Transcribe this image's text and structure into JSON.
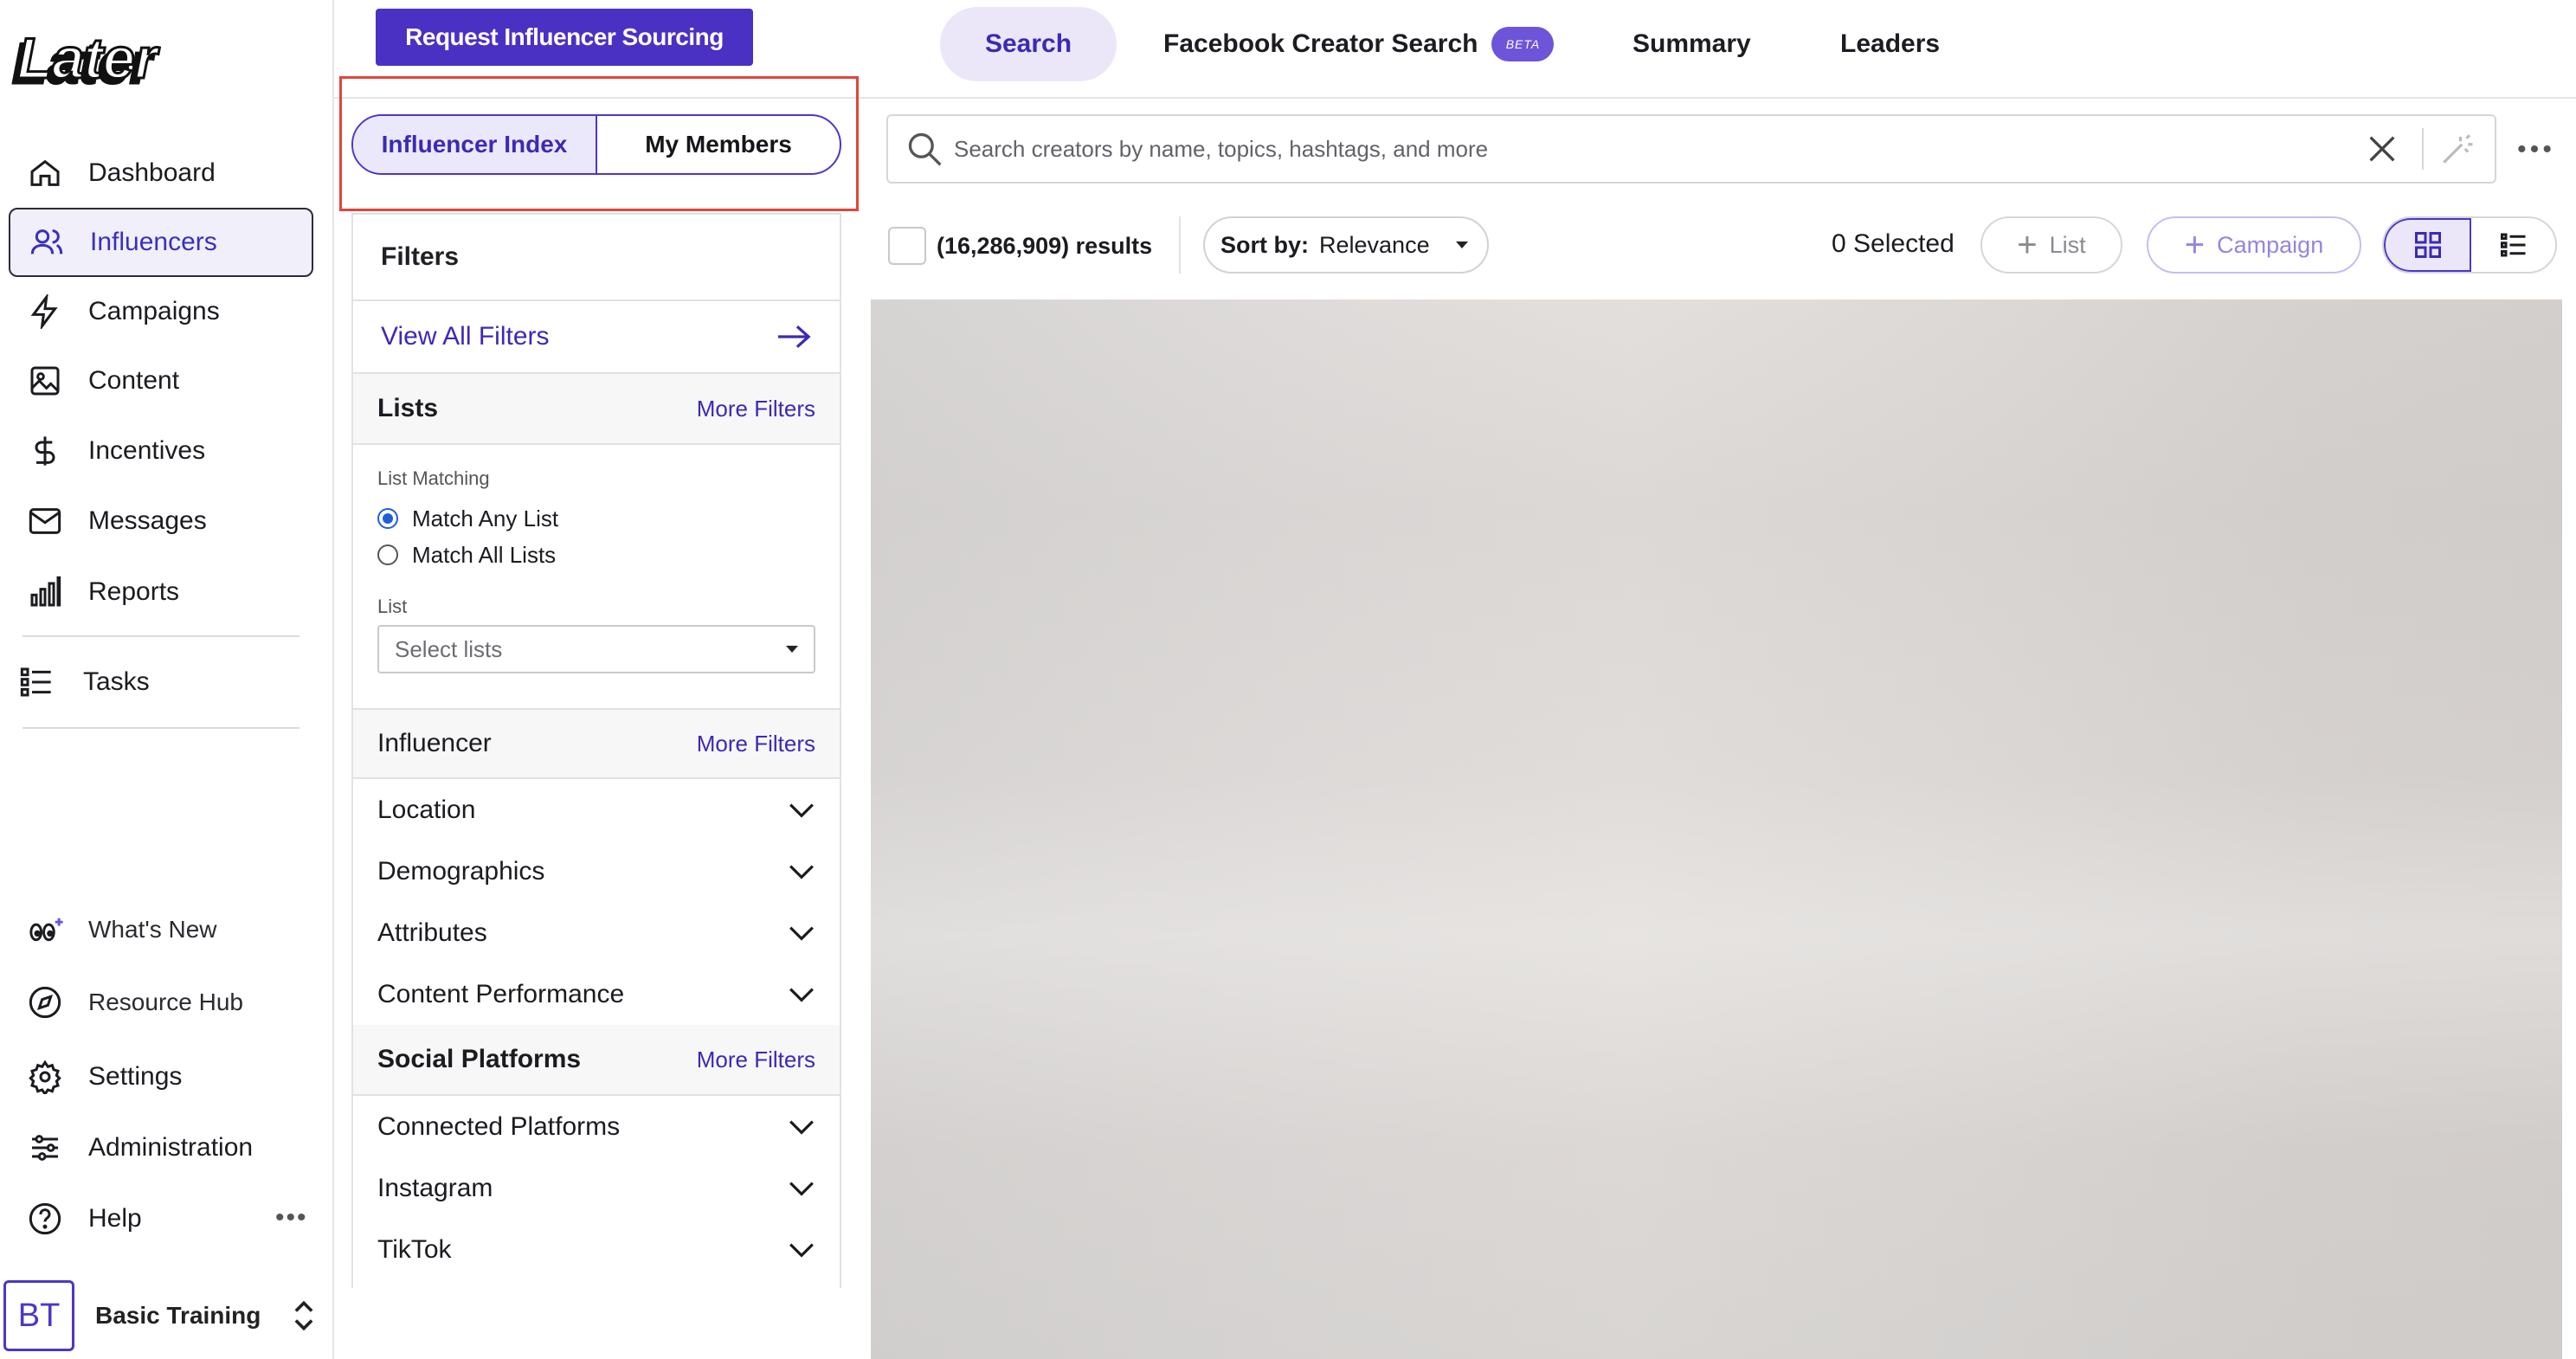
{
  "sidebar": {
    "logo_text": "Later",
    "items": [
      {
        "label": "Dashboard",
        "icon": "home-icon"
      },
      {
        "label": "Influencers",
        "icon": "users-icon",
        "active": true
      },
      {
        "label": "Campaigns",
        "icon": "bolt-icon"
      },
      {
        "label": "Content",
        "icon": "image-icon"
      },
      {
        "label": "Incentives",
        "icon": "dollar-icon"
      },
      {
        "label": "Messages",
        "icon": "mail-icon"
      },
      {
        "label": "Reports",
        "icon": "bar-chart-icon"
      },
      {
        "label": "Tasks",
        "icon": "checklist-icon"
      }
    ],
    "bottom_items": [
      {
        "label": "What's New",
        "icon": "eyes-sparkle-icon"
      },
      {
        "label": "Resource Hub",
        "icon": "compass-icon"
      },
      {
        "label": "Settings",
        "icon": "gear-icon"
      },
      {
        "label": "Administration",
        "icon": "sliders-icon"
      },
      {
        "label": "Help",
        "icon": "help-icon"
      }
    ],
    "help_more": "•••",
    "account": {
      "initials": "BT",
      "name": "Basic Training"
    }
  },
  "topbar": {
    "request_button": "Request Influencer Sourcing",
    "tabs": [
      {
        "label": "Search",
        "active": true
      },
      {
        "label": "Facebook Creator Search",
        "badge": "BETA"
      },
      {
        "label": "Summary"
      },
      {
        "label": "Leaders"
      }
    ]
  },
  "index_toggle": {
    "options": [
      "Influencer Index",
      "My Members"
    ],
    "selected": "Influencer Index"
  },
  "filters": {
    "title": "Filters",
    "view_all": "View All Filters",
    "lists": {
      "title": "Lists",
      "more": "More Filters",
      "matching_label": "List Matching",
      "options": [
        "Match Any List",
        "Match All Lists"
      ],
      "selected": "Match Any List",
      "list_label": "List",
      "list_placeholder": "Select lists"
    },
    "influencer": {
      "title": "Influencer",
      "more": "More Filters",
      "rows": [
        "Location",
        "Demographics",
        "Attributes",
        "Content Performance"
      ]
    },
    "social": {
      "title": "Social Platforms",
      "more": "More Filters",
      "rows": [
        "Connected Platforms",
        "Instagram",
        "TikTok"
      ]
    }
  },
  "search": {
    "placeholder": "Search creators by name, topics, hashtags, and more"
  },
  "toolbar": {
    "results": "(16,286,909) results",
    "sort_label": "Sort by:",
    "sort_value": "Relevance",
    "selected": "0 Selected",
    "list_button": "List",
    "campaign_button": "Campaign",
    "view_mode": "grid"
  },
  "colors": {
    "accent": "#4b30c4",
    "highlight": "#e3443a",
    "active_bg": "#ebe7f8"
  }
}
